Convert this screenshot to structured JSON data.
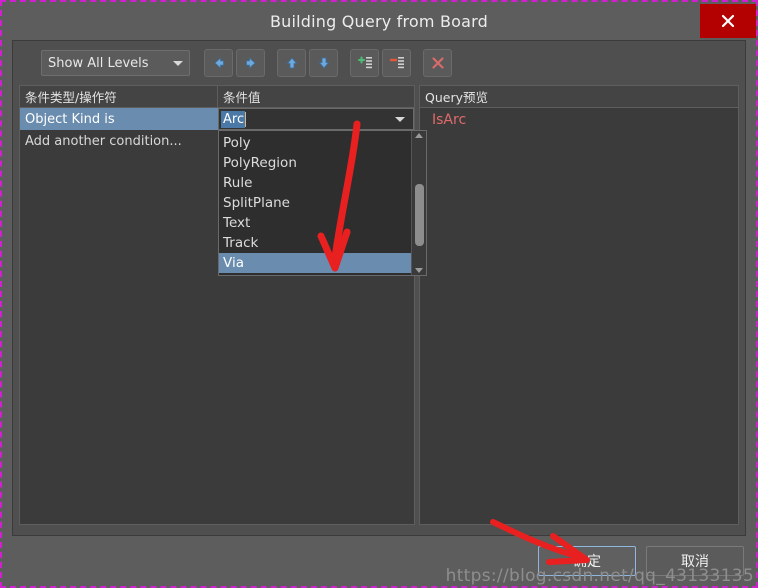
{
  "window": {
    "title": "Building Query from Board",
    "close_icon": "close-icon"
  },
  "toolbar": {
    "level_select": {
      "value": "Show All Levels",
      "caret_icon": "chevron-down-icon"
    },
    "buttons": [
      {
        "name": "move-left-button",
        "icon": "arrow-left-icon"
      },
      {
        "name": "move-right-button",
        "icon": "arrow-right-icon"
      },
      {
        "name": "move-up-button",
        "icon": "arrow-up-icon"
      },
      {
        "name": "move-down-button",
        "icon": "arrow-down-icon"
      },
      {
        "name": "add-condition-button",
        "icon": "add-list-icon"
      },
      {
        "name": "remove-condition-button",
        "icon": "remove-list-icon"
      },
      {
        "name": "clear-all-button",
        "icon": "x-icon"
      }
    ]
  },
  "left_panel": {
    "header_type": "条件类型/操作符",
    "header_value": "条件值",
    "rows": [
      {
        "type": "Object Kind is",
        "selected": true
      },
      {
        "type": "Add another condition...",
        "selected": false
      }
    ],
    "value_editor": {
      "text": "Arc",
      "arrow_icon": "chevron-down-icon"
    },
    "dropdown": {
      "items": [
        {
          "label": "Poly",
          "selected": false
        },
        {
          "label": "PolyRegion",
          "selected": false
        },
        {
          "label": "Rule",
          "selected": false
        },
        {
          "label": "SplitPlane",
          "selected": false
        },
        {
          "label": "Text",
          "selected": false
        },
        {
          "label": "Track",
          "selected": false
        },
        {
          "label": "Via",
          "selected": true
        }
      ],
      "scroll_up_icon": "scroll-up-arrow-icon",
      "scroll_down_icon": "scroll-down-arrow-icon"
    }
  },
  "right_panel": {
    "header": "Query预览",
    "query": "IsArc"
  },
  "footer": {
    "ok_label": "确定",
    "cancel_label": "取消"
  },
  "watermark": "https://blog.csdn.net/qq_43133135",
  "colors": {
    "accent_selection": "#6a8caf",
    "query_text": "#e06a6a",
    "close_button": "#b30000",
    "annotation_arrow": "#e8201f",
    "marquee": "#d020d0"
  }
}
